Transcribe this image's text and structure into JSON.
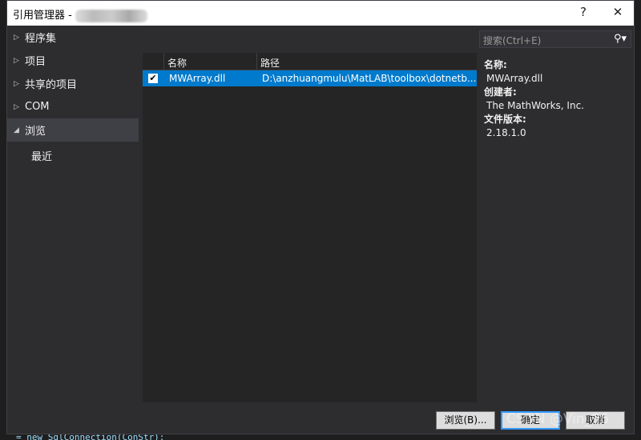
{
  "window": {
    "title": "引用管理器 -",
    "help": "?",
    "close": "✕"
  },
  "nav": [
    {
      "label": "程序集",
      "expanded": false
    },
    {
      "label": "项目",
      "expanded": false
    },
    {
      "label": "共享的项目",
      "expanded": false
    },
    {
      "label": "COM",
      "expanded": false
    },
    {
      "label": "浏览",
      "expanded": true,
      "selected": true
    },
    {
      "label": "最近"
    }
  ],
  "list": {
    "columns": [
      "名称",
      "路径"
    ],
    "rows": [
      {
        "checked": true,
        "name": "MWArray.dll",
        "path": "D:\\anzhuangmulu\\MatLAB\\toolbox\\dotnetb..."
      }
    ]
  },
  "search": {
    "placeholder": "搜索(Ctrl+E)"
  },
  "details": {
    "name_label": "名称:",
    "name": "MWArray.dll",
    "creator_label": "创建者:",
    "creator": "The MathWorks, Inc.",
    "version_label": "文件版本:",
    "version": "2.18.1.0"
  },
  "buttons": {
    "browse": "浏览(B)...",
    "ok": "确定",
    "cancel": "取消"
  },
  "editor": {
    "code": "= new SqlConnection(ConStr);"
  },
  "watermark": "CSDN @Vin_96",
  "colors": {
    "accent": "#007acc",
    "background": "#2d2d30"
  }
}
